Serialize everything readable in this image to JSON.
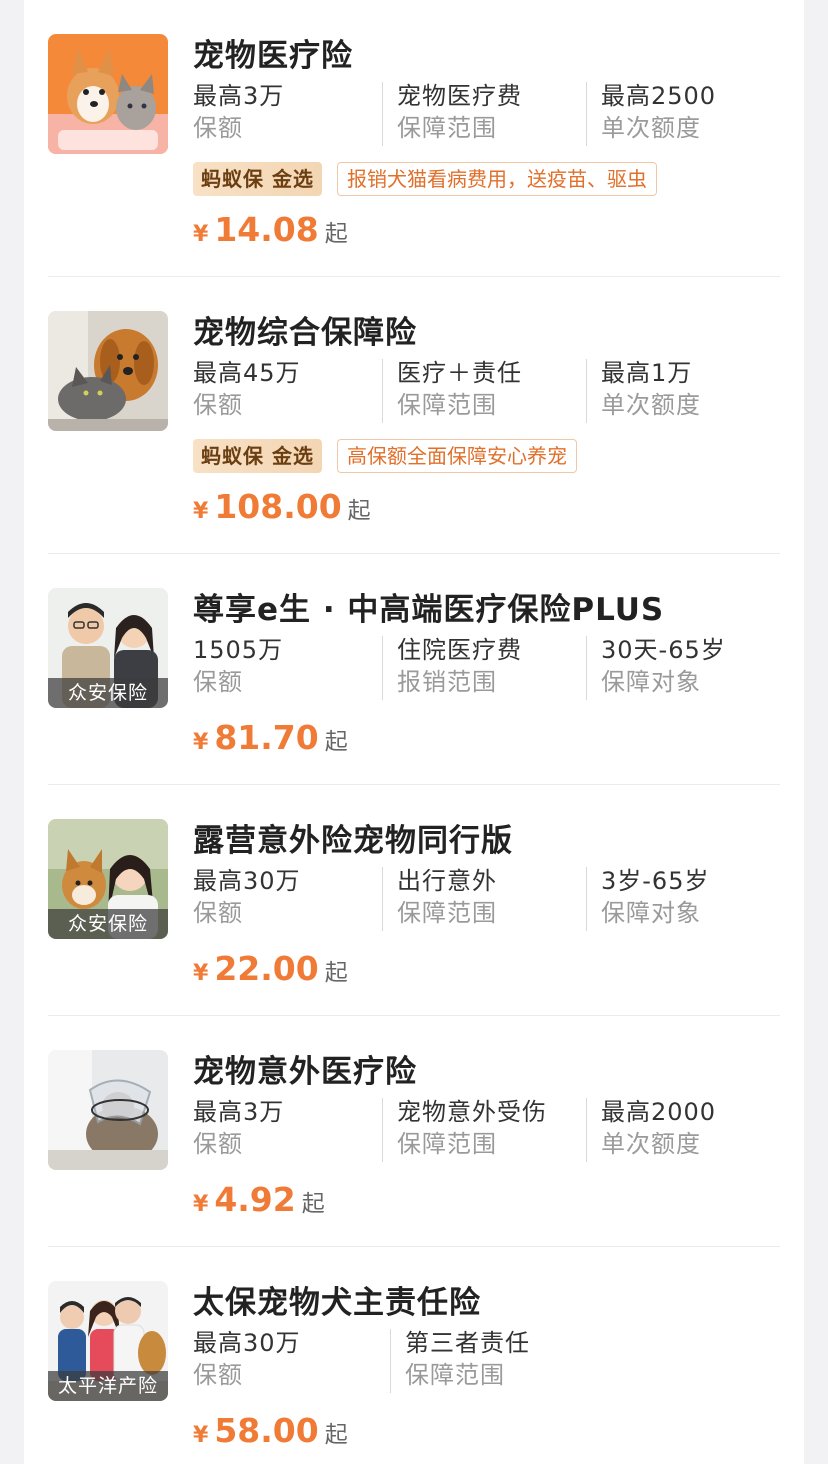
{
  "colors": {
    "price": "#f07b36",
    "tag_text": "#e0702b",
    "tag_border": "#f1c8a6",
    "brand_bg": "#f3d6b4"
  },
  "products": [
    {
      "title": "宠物医疗险",
      "image": "pet-dog-cat-image",
      "stats": [
        {
          "value": "最高3万",
          "label": "保额"
        },
        {
          "value": "宠物医疗费",
          "label": "保障范围"
        },
        {
          "value": "最高2500",
          "label": "单次额度"
        }
      ],
      "brand_tag": "蚂蚁保 金选",
      "desc_tag": "报销犬猫看病费用，送疫苗、驱虫",
      "currency": "¥",
      "price": "14.08",
      "suffix": "起"
    },
    {
      "title": "宠物综合保障险",
      "image": "golden-retriever-cat-image",
      "stats": [
        {
          "value": "最高45万",
          "label": "保额"
        },
        {
          "value": "医疗＋责任",
          "label": "保障范围"
        },
        {
          "value": "最高1万",
          "label": "单次额度"
        }
      ],
      "brand_tag": "蚂蚁保 金选",
      "desc_tag": "高保额全面保障安心养宠",
      "currency": "¥",
      "price": "108.00",
      "suffix": "起"
    },
    {
      "title": "尊享e生 · 中高端医疗保险PLUS",
      "image": "couple-image",
      "badge": "众安保险",
      "stats": [
        {
          "value": "1505万",
          "label": "保额"
        },
        {
          "value": "住院医疗费",
          "label": "报销范围"
        },
        {
          "value": "30天-65岁",
          "label": "保障对象"
        }
      ],
      "currency": "¥",
      "price": "81.70",
      "suffix": "起"
    },
    {
      "title": "露营意外险宠物同行版",
      "image": "woman-shiba-image",
      "badge": "众安保险",
      "stats": [
        {
          "value": "最高30万",
          "label": "保额"
        },
        {
          "value": "出行意外",
          "label": "保障范围"
        },
        {
          "value": "3岁-65岁",
          "label": "保障对象"
        }
      ],
      "currency": "¥",
      "price": "22.00",
      "suffix": "起"
    },
    {
      "title": "宠物意外医疗险",
      "image": "cat-cone-vet-image",
      "stats": [
        {
          "value": "最高3万",
          "label": "保额"
        },
        {
          "value": "宠物意外受伤",
          "label": "保障范围"
        },
        {
          "value": "最高2000",
          "label": "单次额度"
        }
      ],
      "currency": "¥",
      "price": "4.92",
      "suffix": "起"
    },
    {
      "title": "太保宠物犬主责任险",
      "image": "family-dog-image",
      "badge": "太平洋产险",
      "stats": [
        {
          "value": "最高30万",
          "label": "保额"
        },
        {
          "value": "第三者责任",
          "label": "保障范围"
        }
      ],
      "currency": "¥",
      "price": "58.00",
      "suffix": "起"
    }
  ]
}
